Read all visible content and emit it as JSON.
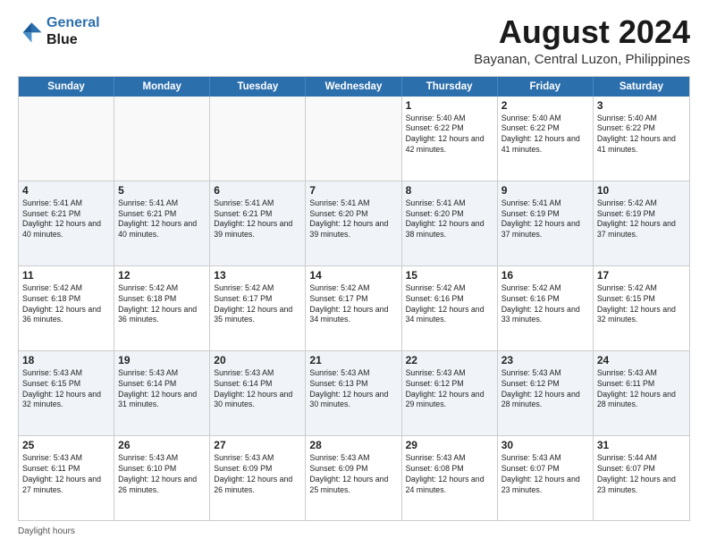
{
  "header": {
    "logo_line1": "General",
    "logo_line2": "Blue",
    "title": "August 2024",
    "subtitle": "Bayanan, Central Luzon, Philippines"
  },
  "footer": {
    "daylight_label": "Daylight hours"
  },
  "weekdays": [
    "Sunday",
    "Monday",
    "Tuesday",
    "Wednesday",
    "Thursday",
    "Friday",
    "Saturday"
  ],
  "weeks": [
    [
      {
        "day": "",
        "info": ""
      },
      {
        "day": "",
        "info": ""
      },
      {
        "day": "",
        "info": ""
      },
      {
        "day": "",
        "info": ""
      },
      {
        "day": "1",
        "info": "Sunrise: 5:40 AM\nSunset: 6:22 PM\nDaylight: 12 hours\nand 42 minutes."
      },
      {
        "day": "2",
        "info": "Sunrise: 5:40 AM\nSunset: 6:22 PM\nDaylight: 12 hours\nand 41 minutes."
      },
      {
        "day": "3",
        "info": "Sunrise: 5:40 AM\nSunset: 6:22 PM\nDaylight: 12 hours\nand 41 minutes."
      }
    ],
    [
      {
        "day": "4",
        "info": "Sunrise: 5:41 AM\nSunset: 6:21 PM\nDaylight: 12 hours\nand 40 minutes."
      },
      {
        "day": "5",
        "info": "Sunrise: 5:41 AM\nSunset: 6:21 PM\nDaylight: 12 hours\nand 40 minutes."
      },
      {
        "day": "6",
        "info": "Sunrise: 5:41 AM\nSunset: 6:21 PM\nDaylight: 12 hours\nand 39 minutes."
      },
      {
        "day": "7",
        "info": "Sunrise: 5:41 AM\nSunset: 6:20 PM\nDaylight: 12 hours\nand 39 minutes."
      },
      {
        "day": "8",
        "info": "Sunrise: 5:41 AM\nSunset: 6:20 PM\nDaylight: 12 hours\nand 38 minutes."
      },
      {
        "day": "9",
        "info": "Sunrise: 5:41 AM\nSunset: 6:19 PM\nDaylight: 12 hours\nand 37 minutes."
      },
      {
        "day": "10",
        "info": "Sunrise: 5:42 AM\nSunset: 6:19 PM\nDaylight: 12 hours\nand 37 minutes."
      }
    ],
    [
      {
        "day": "11",
        "info": "Sunrise: 5:42 AM\nSunset: 6:18 PM\nDaylight: 12 hours\nand 36 minutes."
      },
      {
        "day": "12",
        "info": "Sunrise: 5:42 AM\nSunset: 6:18 PM\nDaylight: 12 hours\nand 36 minutes."
      },
      {
        "day": "13",
        "info": "Sunrise: 5:42 AM\nSunset: 6:17 PM\nDaylight: 12 hours\nand 35 minutes."
      },
      {
        "day": "14",
        "info": "Sunrise: 5:42 AM\nSunset: 6:17 PM\nDaylight: 12 hours\nand 34 minutes."
      },
      {
        "day": "15",
        "info": "Sunrise: 5:42 AM\nSunset: 6:16 PM\nDaylight: 12 hours\nand 34 minutes."
      },
      {
        "day": "16",
        "info": "Sunrise: 5:42 AM\nSunset: 6:16 PM\nDaylight: 12 hours\nand 33 minutes."
      },
      {
        "day": "17",
        "info": "Sunrise: 5:42 AM\nSunset: 6:15 PM\nDaylight: 12 hours\nand 32 minutes."
      }
    ],
    [
      {
        "day": "18",
        "info": "Sunrise: 5:43 AM\nSunset: 6:15 PM\nDaylight: 12 hours\nand 32 minutes."
      },
      {
        "day": "19",
        "info": "Sunrise: 5:43 AM\nSunset: 6:14 PM\nDaylight: 12 hours\nand 31 minutes."
      },
      {
        "day": "20",
        "info": "Sunrise: 5:43 AM\nSunset: 6:14 PM\nDaylight: 12 hours\nand 30 minutes."
      },
      {
        "day": "21",
        "info": "Sunrise: 5:43 AM\nSunset: 6:13 PM\nDaylight: 12 hours\nand 30 minutes."
      },
      {
        "day": "22",
        "info": "Sunrise: 5:43 AM\nSunset: 6:12 PM\nDaylight: 12 hours\nand 29 minutes."
      },
      {
        "day": "23",
        "info": "Sunrise: 5:43 AM\nSunset: 6:12 PM\nDaylight: 12 hours\nand 28 minutes."
      },
      {
        "day": "24",
        "info": "Sunrise: 5:43 AM\nSunset: 6:11 PM\nDaylight: 12 hours\nand 28 minutes."
      }
    ],
    [
      {
        "day": "25",
        "info": "Sunrise: 5:43 AM\nSunset: 6:11 PM\nDaylight: 12 hours\nand 27 minutes."
      },
      {
        "day": "26",
        "info": "Sunrise: 5:43 AM\nSunset: 6:10 PM\nDaylight: 12 hours\nand 26 minutes."
      },
      {
        "day": "27",
        "info": "Sunrise: 5:43 AM\nSunset: 6:09 PM\nDaylight: 12 hours\nand 26 minutes."
      },
      {
        "day": "28",
        "info": "Sunrise: 5:43 AM\nSunset: 6:09 PM\nDaylight: 12 hours\nand 25 minutes."
      },
      {
        "day": "29",
        "info": "Sunrise: 5:43 AM\nSunset: 6:08 PM\nDaylight: 12 hours\nand 24 minutes."
      },
      {
        "day": "30",
        "info": "Sunrise: 5:43 AM\nSunset: 6:07 PM\nDaylight: 12 hours\nand 23 minutes."
      },
      {
        "day": "31",
        "info": "Sunrise: 5:44 AM\nSunset: 6:07 PM\nDaylight: 12 hours\nand 23 minutes."
      }
    ]
  ]
}
